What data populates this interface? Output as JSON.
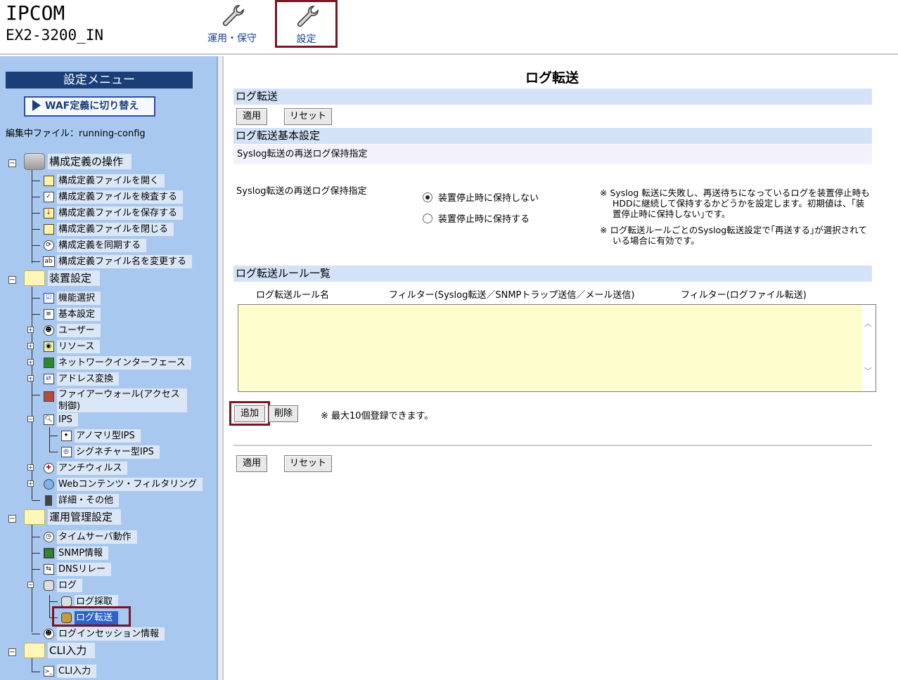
{
  "header": {
    "brand": "IPCOM",
    "device": "EX2-3200_IN",
    "tabs": [
      {
        "label": "運用・保守",
        "icon": "wrench-icon"
      },
      {
        "label": "設定",
        "icon": "wrench-icon"
      }
    ]
  },
  "sidebar": {
    "title": "設定メニュー",
    "waf_button": "WAF定義に切り替え",
    "editing_file": "編集中ファイル：running-config",
    "tree": {
      "config_ops": {
        "label": "構成定義の操作",
        "items": [
          "構成定義ファイルを開く",
          "構成定義ファイルを検査する",
          "構成定義ファイルを保存する",
          "構成定義ファイルを閉じる",
          "構成定義を同期する",
          "構成定義ファイル名を変更する"
        ]
      },
      "device": {
        "label": "装置設定",
        "items": [
          "機能選択",
          "基本設定",
          "ユーザー",
          "リソース",
          "ネットワークインターフェース",
          "アドレス変換",
          "ファイアーウォール(アクセス制御)",
          "IPS",
          "アンチウィルス",
          "Webコンテンツ・フィルタリング",
          "詳細・その他"
        ],
        "ips_children": [
          "アノマリ型IPS",
          "シグネチャー型IPS"
        ]
      },
      "ops_mgmt": {
        "label": "運用管理設定",
        "items": [
          "タイムサーバ動作",
          "SNMP情報",
          "DNSリレー",
          "ログ",
          "ログインセッション情報"
        ],
        "log_children": [
          "ログ採取",
          "ログ転送"
        ]
      },
      "cli": {
        "label": "CLI入力",
        "items": [
          "CLI入力"
        ]
      }
    }
  },
  "main": {
    "title": "ログ転送",
    "section_log_transfer": "ログ転送",
    "apply_label": "適用",
    "reset_label": "リセット",
    "section_basic": "ログ転送基本設定",
    "subrow": "Syslog転送の再送ログ保持指定",
    "field_label": "Syslog転送の再送ログ保持指定",
    "radio_options": [
      {
        "label": "装置停止時に保持しない",
        "checked": true
      },
      {
        "label": "装置停止時に保持する",
        "checked": false
      }
    ],
    "notes": [
      "※ Syslog 転送に失敗し、再送待ちになっているログを装置停止時もHDDに継続して保持するかどうかを設定します。初期値は、｢装置停止時に保持しない｣です。",
      "※ ログ転送ルールごとのSyslog転送設定で｢再送する｣が選択されている場合に有効です。"
    ],
    "section_rules": "ログ転送ルール一覧",
    "columns": [
      "ログ転送ルール名",
      "フィルター(Syslog転送／SNMPトラップ送信／メール送信)",
      "フィルター(ログファイル転送)"
    ],
    "add_label": "追加",
    "delete_label": "削除",
    "max_note": "※ 最大10個登録できます。"
  }
}
